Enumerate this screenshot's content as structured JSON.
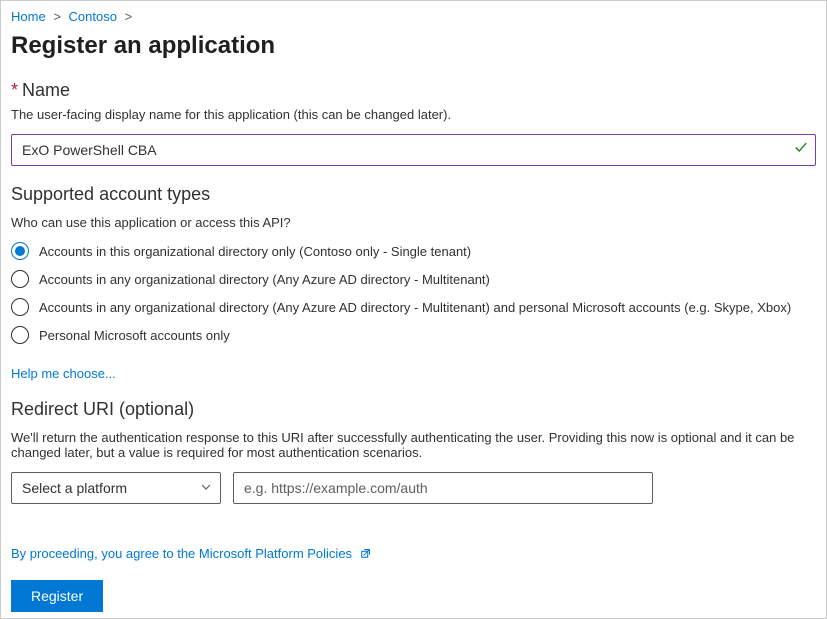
{
  "breadcrumb": {
    "items": [
      {
        "label": "Home"
      },
      {
        "label": "Contoso"
      }
    ],
    "sep": ">"
  },
  "page_title": "Register an application",
  "name_section": {
    "label": "Name",
    "asterisk": "*",
    "description": "The user-facing display name for this application (this can be changed later).",
    "value": "ExO PowerShell CBA"
  },
  "account_types": {
    "heading": "Supported account types",
    "question": "Who can use this application or access this API?",
    "options": [
      {
        "label": "Accounts in this organizational directory only (Contoso only - Single tenant)",
        "selected": true
      },
      {
        "label": "Accounts in any organizational directory (Any Azure AD directory - Multitenant)",
        "selected": false
      },
      {
        "label": "Accounts in any organizational directory (Any Azure AD directory - Multitenant) and personal Microsoft accounts (e.g. Skype, Xbox)",
        "selected": false
      },
      {
        "label": "Personal Microsoft accounts only",
        "selected": false
      }
    ],
    "help_link": "Help me choose..."
  },
  "redirect_uri": {
    "heading": "Redirect URI (optional)",
    "description": "We'll return the authentication response to this URI after successfully authenticating the user. Providing this now is optional and it can be changed later, but a value is required for most authentication scenarios.",
    "platform_placeholder": "Select a platform",
    "uri_placeholder": "e.g. https://example.com/auth"
  },
  "policy_text": "By proceeding, you agree to the Microsoft Platform Policies",
  "register_label": "Register"
}
